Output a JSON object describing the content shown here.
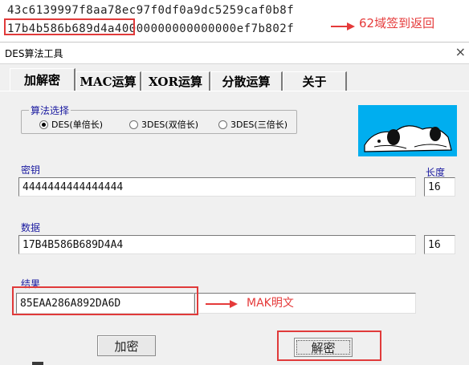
{
  "top_text": {
    "line1": "43c6139997f8aa78ec97f0df0a9dc5259caf0b8f",
    "line2": "17b4b586b689d4a40000000000000000ef7b802f",
    "annotation": "62域签到返回"
  },
  "window": {
    "title": "DES算法工具",
    "close_glyph": "×"
  },
  "tabs": [
    {
      "label": "加解密"
    },
    {
      "label": "MAC运算"
    },
    {
      "label": "XOR运算"
    },
    {
      "label": "分散运算"
    },
    {
      "label": "关于"
    }
  ],
  "algorithm": {
    "group_title": "算法选择",
    "options": [
      "DES(单倍长)",
      "3DES(双倍长)",
      "3DES(三倍长)"
    ],
    "selected": "DES(单倍长)"
  },
  "key": {
    "label": "密钥",
    "value": "4444444444444444",
    "length_label": "长度",
    "length": "16"
  },
  "data": {
    "label": "数据",
    "value": "17B4B586B689D4A4",
    "length": "16"
  },
  "result": {
    "label": "结果",
    "value": "85EAA286A892DA6D",
    "annotation": "MAK明文"
  },
  "buttons": {
    "encrypt": "加密",
    "decrypt": "解密"
  },
  "colors": {
    "annotation_red": "#e53a3a",
    "label_blue": "#1a1aa0",
    "image_bg": "#00aeef"
  },
  "icons": {
    "arrow": "right-arrow-icon",
    "radio": "radio-icon"
  }
}
